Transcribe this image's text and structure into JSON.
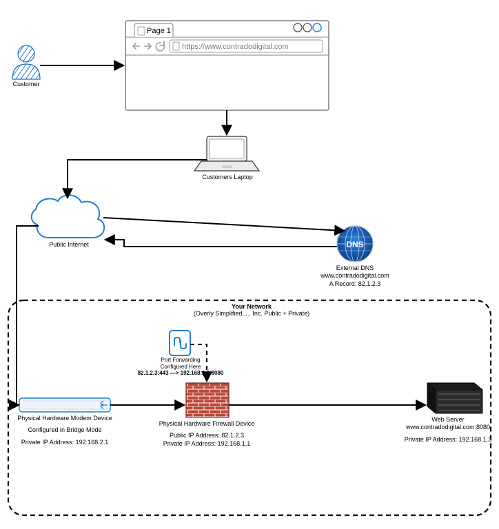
{
  "browser": {
    "tab_label": "Page 1",
    "address_bar": "https://www.contradodigital.com"
  },
  "customer": {
    "label": "Customer"
  },
  "laptop": {
    "label": "Customers Laptop"
  },
  "cloud": {
    "label": "Public Internet"
  },
  "dns": {
    "label": "External DNS",
    "domain": "www.contradodigital.com",
    "record": "A Record: 82.1.2.3"
  },
  "network": {
    "title1": "Your Network",
    "title2": "(Overly Simplified..... Inc. Public + Private)"
  },
  "port_forwarding": {
    "label": "Port Forwarding",
    "label2": "Configured Here",
    "mapping": "82.1.2.3:443 ---> 192.168.1.3:8080"
  },
  "modem": {
    "title": "Physical Hardware Modem Device",
    "line1": "Configured in Bridge Mode",
    "line2": "Private IP Address: 192.168.2.1"
  },
  "firewall": {
    "title": "Physical Hardware Firewall Device",
    "line1": "Public IP Address: 82.1.2.3",
    "line2": "Private IP Address: 192.168.1.1"
  },
  "webserver": {
    "title": "Web Server",
    "domain": "www.contradodigital.com:8080",
    "line2": "Private IP Address: 192.168.1.3"
  },
  "colors": {
    "blue": "#1e7fd6",
    "dns_blue": "#0b4fa4",
    "brick": "#b03a2e",
    "server": "#2c2c2c"
  }
}
